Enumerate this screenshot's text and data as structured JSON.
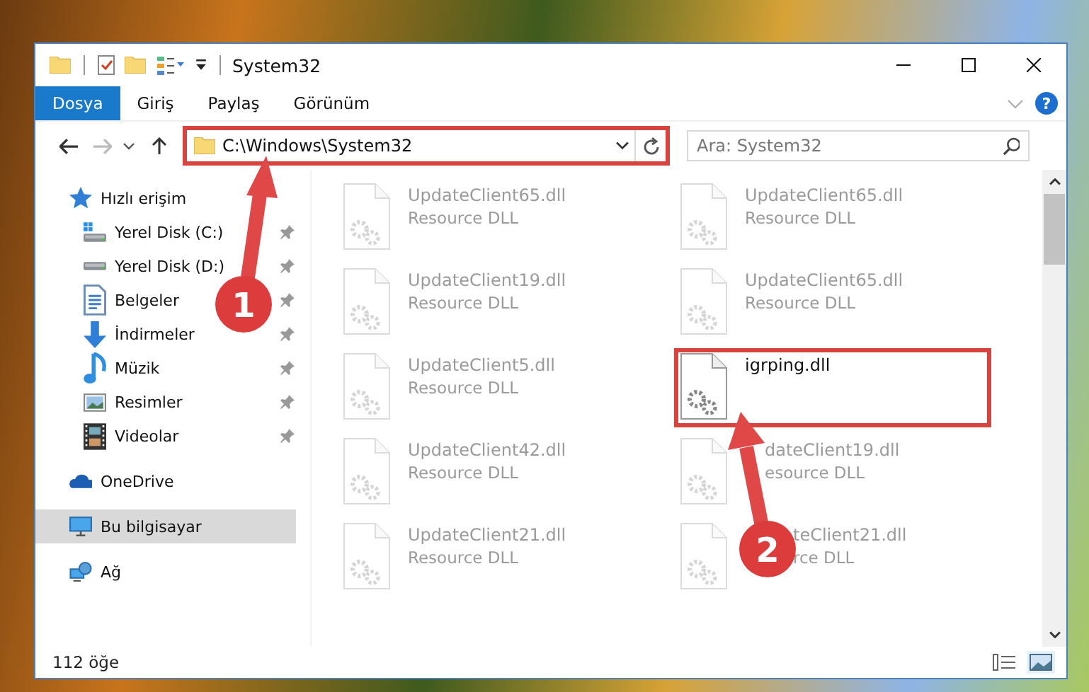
{
  "window": {
    "title": "System32"
  },
  "ribbon_tabs": [
    {
      "label": "Dosya",
      "selected": true
    },
    {
      "label": "Giriş",
      "selected": false
    },
    {
      "label": "Paylaş",
      "selected": false
    },
    {
      "label": "Görünüm",
      "selected": false
    }
  ],
  "help": "?",
  "address": {
    "path": "C:\\Windows\\System32",
    "highlighted": true
  },
  "search": {
    "placeholder": "Ara: System32"
  },
  "nav": [
    {
      "label": "Hızlı erişim",
      "kind": "star",
      "pinned": false,
      "selected": false
    },
    {
      "label": "Yerel Disk (C:)",
      "kind": "sysdrive",
      "pinned": true,
      "selected": false
    },
    {
      "label": "Yerel Disk (D:)",
      "kind": "drive",
      "pinned": true,
      "selected": false
    },
    {
      "label": "Belgeler",
      "kind": "doc",
      "pinned": true,
      "selected": false
    },
    {
      "label": "İndirmeler",
      "kind": "download",
      "pinned": true,
      "selected": false
    },
    {
      "label": "Müzik",
      "kind": "music",
      "pinned": true,
      "selected": false
    },
    {
      "label": "Resimler",
      "kind": "picture",
      "pinned": true,
      "selected": false
    },
    {
      "label": "Videolar",
      "kind": "video",
      "pinned": true,
      "selected": false
    },
    {
      "label": "OneDrive",
      "kind": "cloud",
      "pinned": false,
      "selected": false
    },
    {
      "label": "Bu bilgisayar",
      "kind": "pc",
      "pinned": false,
      "selected": true
    },
    {
      "label": "Ağ",
      "kind": "network",
      "pinned": false,
      "selected": false
    }
  ],
  "files": [
    {
      "name": "UpdateClient65.dll",
      "type": "Resource DLL",
      "kind": "plain",
      "dimmed": true,
      "highlighted": false
    },
    {
      "name": "UpdateClient65.dll",
      "type": "Resource DLL",
      "kind": "plain",
      "dimmed": true,
      "highlighted": false
    },
    {
      "name": "UpdateClient19.dll",
      "type": "Resource DLL",
      "kind": "plain",
      "dimmed": true,
      "highlighted": false
    },
    {
      "name": "UpdateClient65.dll",
      "type": "Resource DLL",
      "kind": "plain",
      "dimmed": true,
      "highlighted": false
    },
    {
      "name": "UpdateClient5.dll",
      "type": "Resource DLL",
      "kind": "plain",
      "dimmed": true,
      "highlighted": false
    },
    {
      "name": "igrping.dll",
      "kind": "plain",
      "dimmed": false,
      "highlighted": true
    },
    {
      "name": "UpdateClient42.dll",
      "type": "Resource DLL",
      "kind": "plain",
      "dimmed": true,
      "highlighted": false
    },
    {
      "name": "dateClient19.dll",
      "type": "esource DLL",
      "kind": "under_arrow",
      "dimmed": true,
      "highlighted": false
    },
    {
      "name": "UpdateClient21.dll",
      "type": "Resource DLL",
      "kind": "plain",
      "dimmed": true,
      "highlighted": false
    },
    {
      "name": "teClient21.dll",
      "type": "rce DLL",
      "kind": "under_marker",
      "dimmed": true,
      "highlighted": false
    }
  ],
  "status_bar": {
    "count": "112 öğe"
  },
  "annotations": [
    {
      "label": "1"
    },
    {
      "label": "2"
    }
  ]
}
